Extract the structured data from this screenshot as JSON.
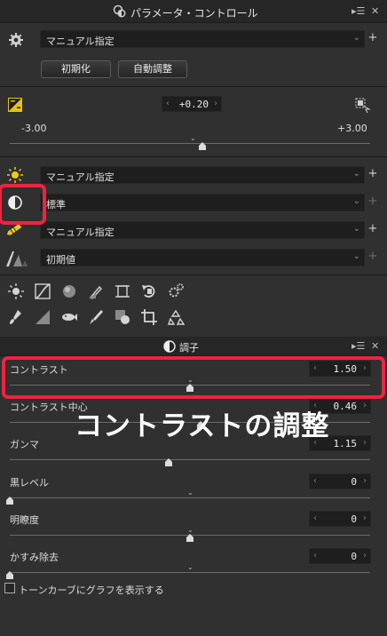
{
  "panel": {
    "title": "パラメータ・コントロール",
    "menu_glyph": "▸☰",
    "close_glyph": "✕"
  },
  "preset": {
    "mode": "マニュアル指定",
    "reset_label": "初期化",
    "auto_label": "自動調整"
  },
  "exposure": {
    "value": "+0.20",
    "min_label": "-3.00",
    "max_label": "+3.00",
    "value_num": 0.2,
    "range": [
      -3,
      3
    ]
  },
  "rows": {
    "brightness_mode": "マニュアル指定",
    "tone_mode": "標準",
    "color_mode": "マニュアル指定",
    "sharp_mode": "初期値"
  },
  "tone_panel": {
    "title": "調子",
    "params": [
      {
        "label": "コントラスト",
        "value": "1.50",
        "pos": 0.5
      },
      {
        "label": "コントラスト中心",
        "value": "0.46",
        "pos": 0.53
      },
      {
        "label": "ガンマ",
        "value": "1.15",
        "pos": 0.44
      },
      {
        "label": "黒レベル",
        "value": "0",
        "pos": 0.0
      },
      {
        "label": "明瞭度",
        "value": "0",
        "pos": 0.5
      },
      {
        "label": "かすみ除去",
        "value": "0",
        "pos": 0.0
      }
    ],
    "checkbox_label": "トーンカーブにグラフを表示する"
  },
  "annotation": {
    "text": "コントラストの調整",
    "color": "#f0233f"
  },
  "icons": {
    "gear": "gear-icon",
    "exposure": "exposure-icon",
    "sun": "sun-icon",
    "contrast": "contrast-icon",
    "color": "color-pencil-icon",
    "sharp": "sharpness-icon"
  }
}
